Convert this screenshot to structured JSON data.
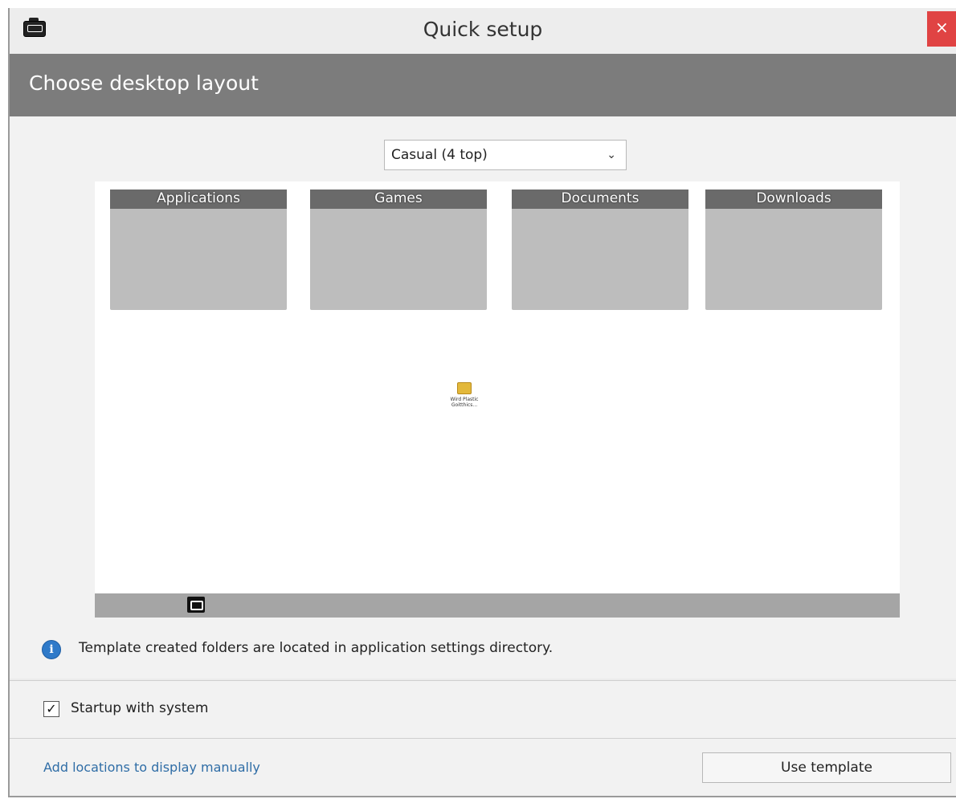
{
  "window": {
    "title": "Quick setup",
    "close_glyph": "×",
    "app_icon": "fences-app-icon"
  },
  "header": {
    "title": "Choose desktop layout"
  },
  "layout_select": {
    "value": "Casual (4 top)",
    "chevron": "⌄"
  },
  "preview": {
    "folders": [
      {
        "label": "Applications"
      },
      {
        "label": "Games"
      },
      {
        "label": "Documents"
      },
      {
        "label": "Downloads"
      }
    ],
    "desktop_icon": {
      "name": "package-icon",
      "label": "Wird Plastic Goitthics..."
    },
    "taskbar_icon": "app-taskbar-icon"
  },
  "info": {
    "icon": "info-icon",
    "text": "Template created folders are located in application settings directory."
  },
  "startup": {
    "checked": true,
    "check_glyph": "✓",
    "label": "Startup with system"
  },
  "footer": {
    "link_label": "Add locations to display manually",
    "button_label": "Use template"
  },
  "colors": {
    "header_band": "#7c7c7c",
    "folder_body": "#bdbdbd",
    "folder_head": "#6a6a6a",
    "close_button": "#e04343",
    "link": "#2f6da6",
    "info_icon": "#2f7ac9"
  }
}
